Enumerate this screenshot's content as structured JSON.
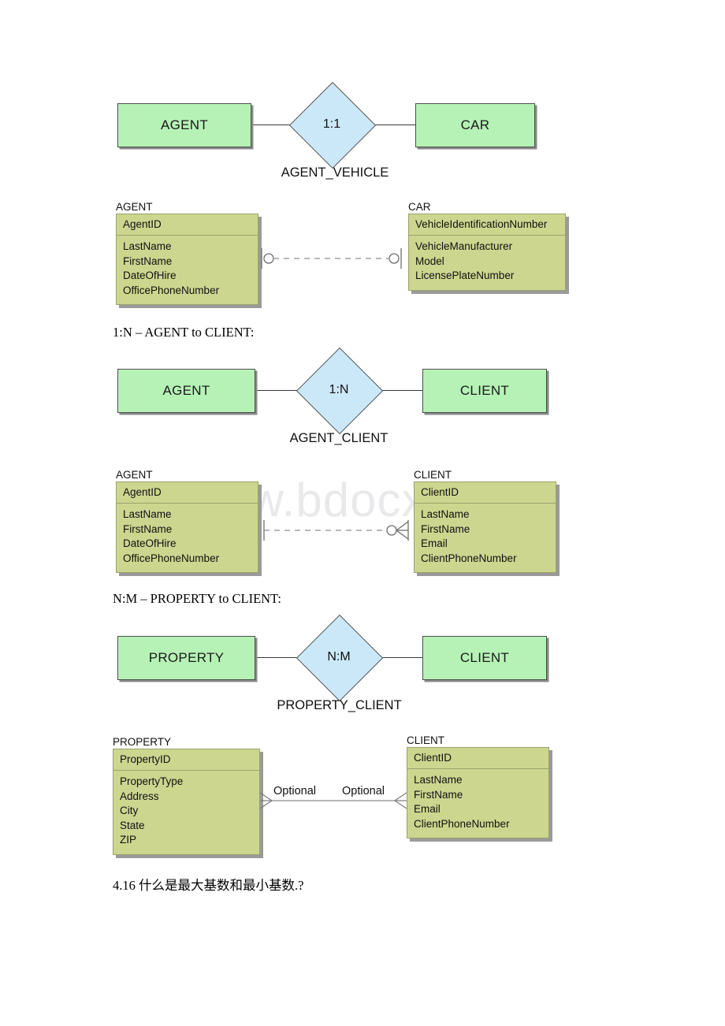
{
  "watermark": "www.bdocx.com",
  "sections": [
    {
      "id": "one-to-one",
      "relationship": {
        "left_entity": "AGENT",
        "right_entity": "CAR",
        "cardinality": "1:1",
        "name": "AGENT_VEHICLE"
      },
      "tables": {
        "left": {
          "title": "AGENT",
          "primary_key": "AgentID",
          "attributes": [
            "LastName",
            "FirstName",
            "DateOfHire",
            "OfficePhoneNumber"
          ]
        },
        "right": {
          "title": "CAR",
          "primary_key": "VehicleIdentificationNumber",
          "attributes": [
            "VehicleManufacturer",
            "Model",
            "LicensePlateNumber"
          ]
        }
      }
    },
    {
      "id": "one-to-many",
      "heading": "1:N – AGENT to CLIENT:",
      "relationship": {
        "left_entity": "AGENT",
        "right_entity": "CLIENT",
        "cardinality": "1:N",
        "name": "AGENT_CLIENT"
      },
      "tables": {
        "left": {
          "title": "AGENT",
          "primary_key": "AgentID",
          "attributes": [
            "LastName",
            "FirstName",
            "DateOfHire",
            "OfficePhoneNumber"
          ]
        },
        "right": {
          "title": "CLIENT",
          "primary_key": "ClientID",
          "attributes": [
            "LastName",
            "FirstName",
            "Email",
            "ClientPhoneNumber"
          ]
        }
      }
    },
    {
      "id": "many-to-many",
      "heading": "N:M – PROPERTY to CLIENT:",
      "relationship": {
        "left_entity": "PROPERTY",
        "right_entity": "CLIENT",
        "cardinality": "N:M",
        "name": "PROPERTY_CLIENT"
      },
      "tables": {
        "left": {
          "title": "PROPERTY",
          "primary_key": "PropertyID",
          "attributes": [
            "PropertyType",
            "Address",
            "City",
            "State",
            "ZIP"
          ]
        },
        "right": {
          "title": "CLIENT",
          "primary_key": "ClientID",
          "attributes": [
            "LastName",
            "FirstName",
            "Email",
            "ClientPhoneNumber"
          ]
        }
      },
      "connector_labels": {
        "left": "Optional",
        "right": "Optional"
      }
    }
  ],
  "footer_question": "4.16 什么是最大基数和最小基数.?",
  "colors": {
    "entity_fill": "#b6f2b6",
    "diamond_fill": "#cbe8f8",
    "table_fill": "#ccd68f",
    "table_border": "#9aa36a",
    "shadow": "#9a9a9a",
    "line": "#3a3a3a"
  }
}
